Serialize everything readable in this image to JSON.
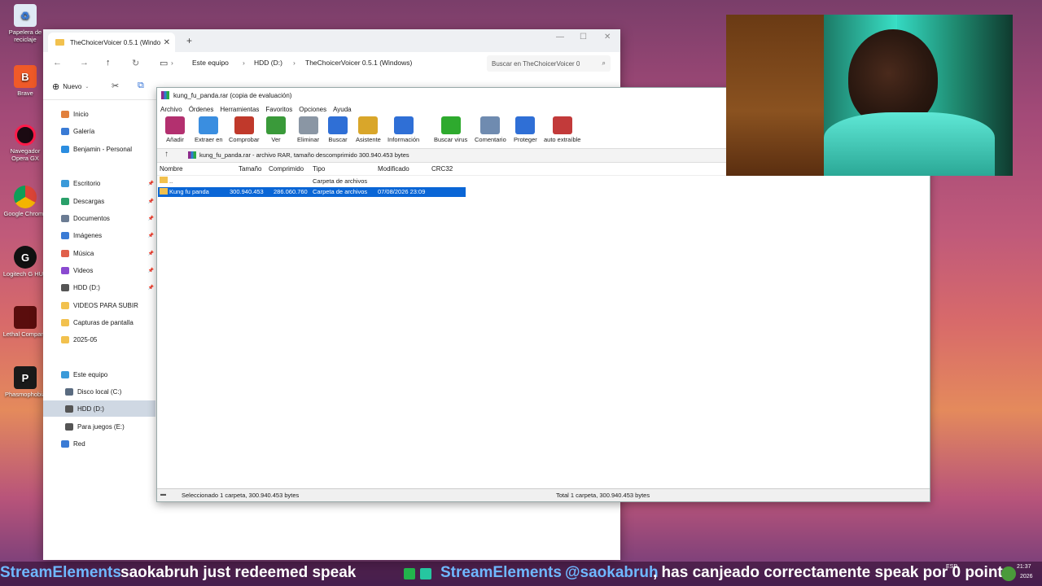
{
  "desktop": {
    "icons": [
      {
        "label": "Papelera de reciclaje",
        "color": "#cfe3f7"
      },
      {
        "label": "Brave",
        "color": "#f05a28"
      },
      {
        "label": "Navegador Opera GX",
        "color": "#d41c3c"
      },
      {
        "label": "Google Chrome",
        "color": "#3aa856"
      },
      {
        "label": "Logitech G HUB",
        "color": "#1b1b1b"
      },
      {
        "label": "Lethal Company",
        "color": "#8a1a1a"
      },
      {
        "label": "Phasmophobia",
        "color": "#222222"
      }
    ]
  },
  "explorer": {
    "tab_title": "TheChoicerVoicer 0.5.1 (Windo",
    "breadcrumbs": [
      "Este equipo",
      "HDD (D:)",
      "TheChoicerVoicer 0.5.1 (Windows)"
    ],
    "search_placeholder": "Buscar en TheChoicerVoicer 0",
    "new_label": "Nuevo",
    "sidebar": [
      {
        "label": "Inicio",
        "color": "#e1803c"
      },
      {
        "label": "Galería",
        "color": "#3a7bd5"
      },
      {
        "label": "Benjamin - Personal",
        "color": "#2b8de0"
      },
      {
        "label": "Escritorio",
        "color": "#3a9ad9"
      },
      {
        "label": "Descargas",
        "color": "#2aa06a"
      },
      {
        "label": "Documentos",
        "color": "#6b7c93"
      },
      {
        "label": "Imágenes",
        "color": "#3a7bd5"
      },
      {
        "label": "Música",
        "color": "#e0604a"
      },
      {
        "label": "Videos",
        "color": "#8a4ad0"
      },
      {
        "label": "HDD (D:)",
        "color": "#555555"
      },
      {
        "label": "VIDEOS PARA SUBIR",
        "color": "#f2c14e"
      },
      {
        "label": "Capturas de pantalla",
        "color": "#f2c14e"
      },
      {
        "label": "2025-05",
        "color": "#f2c14e"
      },
      {
        "label": "Este equipo",
        "color": "#3a9ad9"
      },
      {
        "label": "Disco local (C:)",
        "color": "#5a6b80"
      },
      {
        "label": "HDD (D:)",
        "color": "#555555"
      },
      {
        "label": "Para juegos (E:)",
        "color": "#555555"
      },
      {
        "label": "Red",
        "color": "#3a7bd5"
      }
    ]
  },
  "winrar": {
    "title": "kung_fu_panda.rar (copia de evaluación)",
    "menu": [
      "Archivo",
      "Órdenes",
      "Herramientas",
      "Favoritos",
      "Opciones",
      "Ayuda"
    ],
    "tools": [
      {
        "label": "Añadir",
        "color": "#b3306f"
      },
      {
        "label": "Extraer en",
        "color": "#3a8ee0"
      },
      {
        "label": "Comprobar",
        "color": "#c0392b"
      },
      {
        "label": "Ver",
        "color": "#3a9a3a"
      },
      {
        "label": "Eliminar",
        "color": "#8a96a4"
      },
      {
        "label": "Buscar",
        "color": "#2f6fd6"
      },
      {
        "label": "Asistente",
        "color": "#d9a62a"
      },
      {
        "label": "Información",
        "color": "#2f6fd6"
      },
      {
        "label": "Buscar virus",
        "color": "#2eaa2e"
      },
      {
        "label": "Comentario",
        "color": "#6f8bb0"
      },
      {
        "label": "Proteger",
        "color": "#2f6fd6"
      },
      {
        "label": "auto extraíble",
        "color": "#c23a3a"
      }
    ],
    "path": "kung_fu_panda.rar - archivo RAR, tamaño descomprimido 300.940.453 bytes",
    "columns": [
      "Nombre",
      "Tamaño",
      "Comprimido",
      "Tipo",
      "Modificado",
      "CRC32"
    ],
    "rows": [
      {
        "name": "..",
        "size": "",
        "packed": "",
        "type": "Carpeta de archivos",
        "modified": "",
        "crc": ""
      },
      {
        "name": "Kung fu panda",
        "size": "300.940.453",
        "packed": "286.060.760",
        "type": "Carpeta de archivos",
        "modified": "07/08/2026 23:09",
        "crc": ""
      }
    ],
    "status_left": "Seleccionado 1 carpeta, 300.940.453 bytes",
    "status_right": "Total 1 carpeta, 300.940.453 bytes"
  },
  "ticker": {
    "left_user": "StreamElements",
    "left_msg": "saokabruh just redeemed speak",
    "right_user": "StreamElements",
    "right_mention": "@saokabruh",
    "right_msg": ", has canjeado correctamente speak por 0 points.",
    "lang": "ESP",
    "clock": "21:37",
    "year": "2026"
  }
}
